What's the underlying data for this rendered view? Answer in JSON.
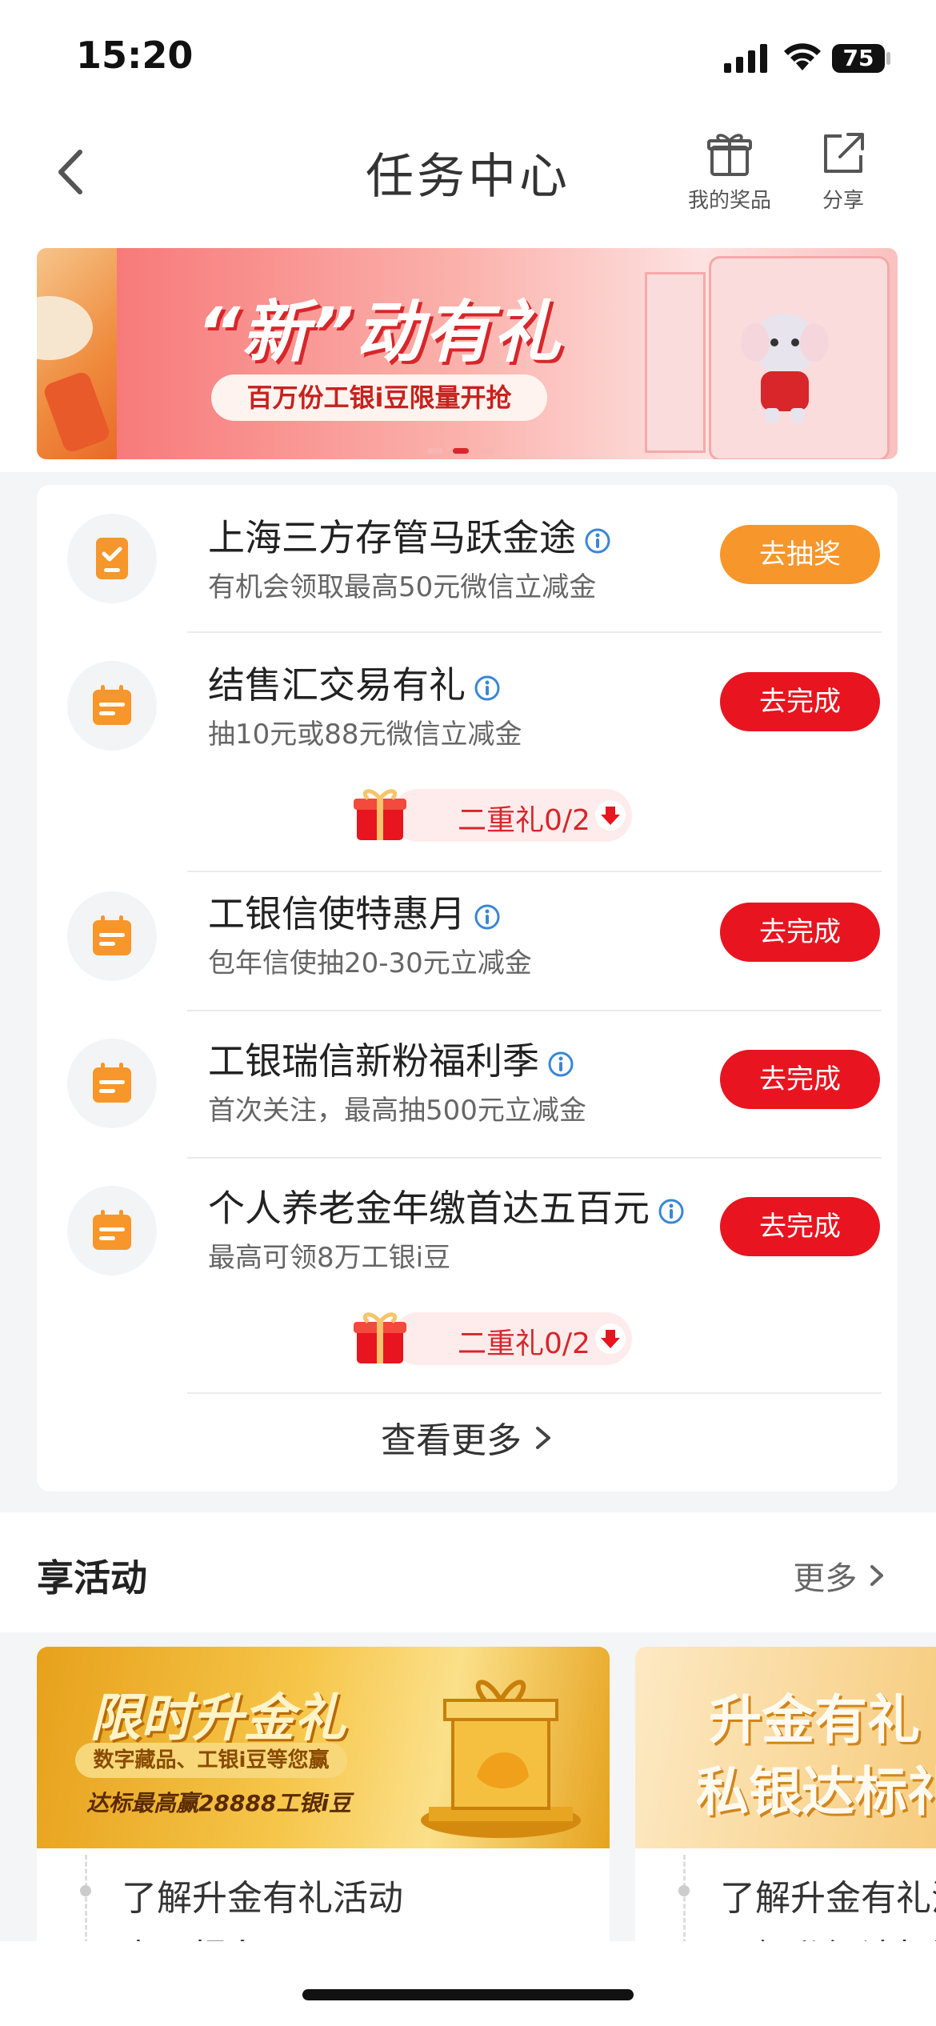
{
  "status": {
    "time": "15:20",
    "battery": "75"
  },
  "nav": {
    "title": "任务中心",
    "prizes_label": "我的奖品",
    "share_label": "分享"
  },
  "banner": {
    "title": "“新”动有礼",
    "subtitle": "百万份工银i豆限量开抢",
    "active_index": 1,
    "count": 3
  },
  "tasks": [
    {
      "name": "上海三方存管马跃金途",
      "desc": "有机会领取最高50元微信立减金",
      "button": "去抽奖",
      "icon": "phone-check-icon"
    },
    {
      "name": "结售汇交易有礼",
      "desc": "抽10元或88元微信立减金",
      "button": "去完成",
      "icon": "calendar-icon",
      "gift": "二重礼0/2"
    },
    {
      "name": "工银信使特惠月",
      "desc": "包年信使抽20-30元立减金",
      "button": "去完成",
      "icon": "calendar-icon"
    },
    {
      "name": "工银瑞信新粉福利季",
      "desc": "首次关注，最高抽500元立减金",
      "button": "去完成",
      "icon": "calendar-icon"
    },
    {
      "name": "个人养老金年缴首达五百元",
      "desc": "最高可领8万工银i豆",
      "button": "去完成",
      "icon": "calendar-icon",
      "gift": "二重礼0/2"
    }
  ],
  "view_more": "查看更多",
  "activities": {
    "title": "享活动",
    "more": "更多",
    "cards": [
      {
        "img_title": "限时升金礼",
        "img_sub": "数字藏品、工银i豆等您赢",
        "img_sub2": "达标最高赢28888工银i豆",
        "line1": "了解升金有礼活动",
        "line2": "立即报名"
      },
      {
        "img_title": "升金有礼",
        "img_title2": "私银达标礼",
        "line1": "了解升金有礼活动",
        "line2": "了解私银达标活动"
      }
    ]
  },
  "colors": {
    "red": "#e8141f",
    "orange": "#f7962b",
    "icon_orange": "#f7962b"
  }
}
